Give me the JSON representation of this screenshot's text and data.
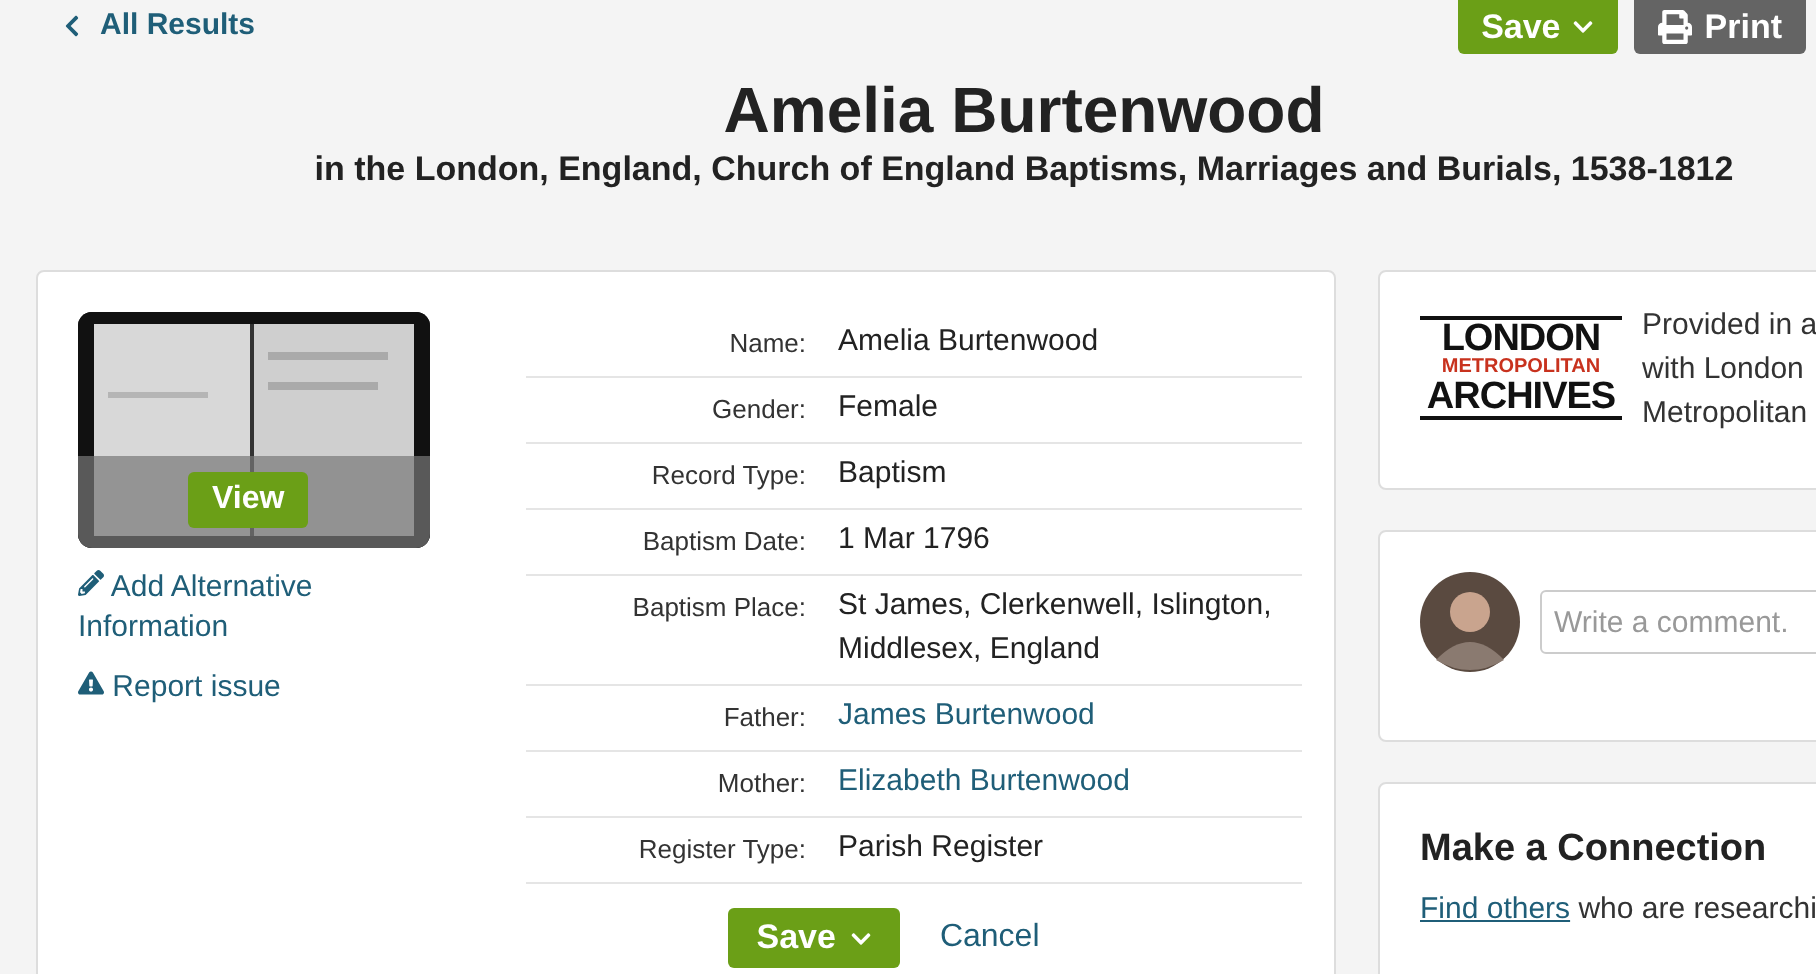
{
  "back_link": "All Results",
  "header_buttons": [
    {
      "kind": "save",
      "label": "Save"
    },
    {
      "kind": "print",
      "label": "Print"
    }
  ],
  "title": "Amelia Burtenwood",
  "subtitle": "in the London, England, Church of England Baptisms, Marriages and Burials, 1538-1812",
  "record_image": {
    "kind": "picture",
    "button": "View"
  },
  "side_links": [
    {
      "kind": "edit",
      "label": "Add Alternative Information"
    },
    {
      "kind": "warning",
      "label": "Report issue"
    }
  ],
  "fields": [
    {
      "label": "Name:",
      "value": "Amelia Burtenwood",
      "link": false
    },
    {
      "label": "Gender:",
      "value": "Female",
      "link": false
    },
    {
      "label": "Record Type:",
      "value": "Baptism",
      "link": false
    },
    {
      "label": "Baptism Date:",
      "value": "1 Mar 1796",
      "link": false
    },
    {
      "label": "Baptism Place:",
      "value": "St James, Clerkenwell, Islington, Middlesex, England",
      "link": false
    },
    {
      "label": "Father:",
      "value": "James Burtenwood",
      "link": true
    },
    {
      "label": "Mother:",
      "value": "Elizabeth Burtenwood",
      "link": true
    },
    {
      "label": "Register Type:",
      "value": "Parish Register",
      "link": false
    }
  ],
  "form_buttons": {
    "save": "Save",
    "cancel": "Cancel"
  },
  "provider": {
    "logo_lines": [
      "LONDON",
      "METROPOLITAN",
      "ARCHIVES"
    ],
    "text_lines": [
      "Provided in a",
      "with London",
      "Metropolitan"
    ]
  },
  "comment": {
    "placeholder": "Write a comment."
  },
  "connection": {
    "title": "Make a Connection",
    "link": "Find others",
    "text": "who are researchi"
  }
}
